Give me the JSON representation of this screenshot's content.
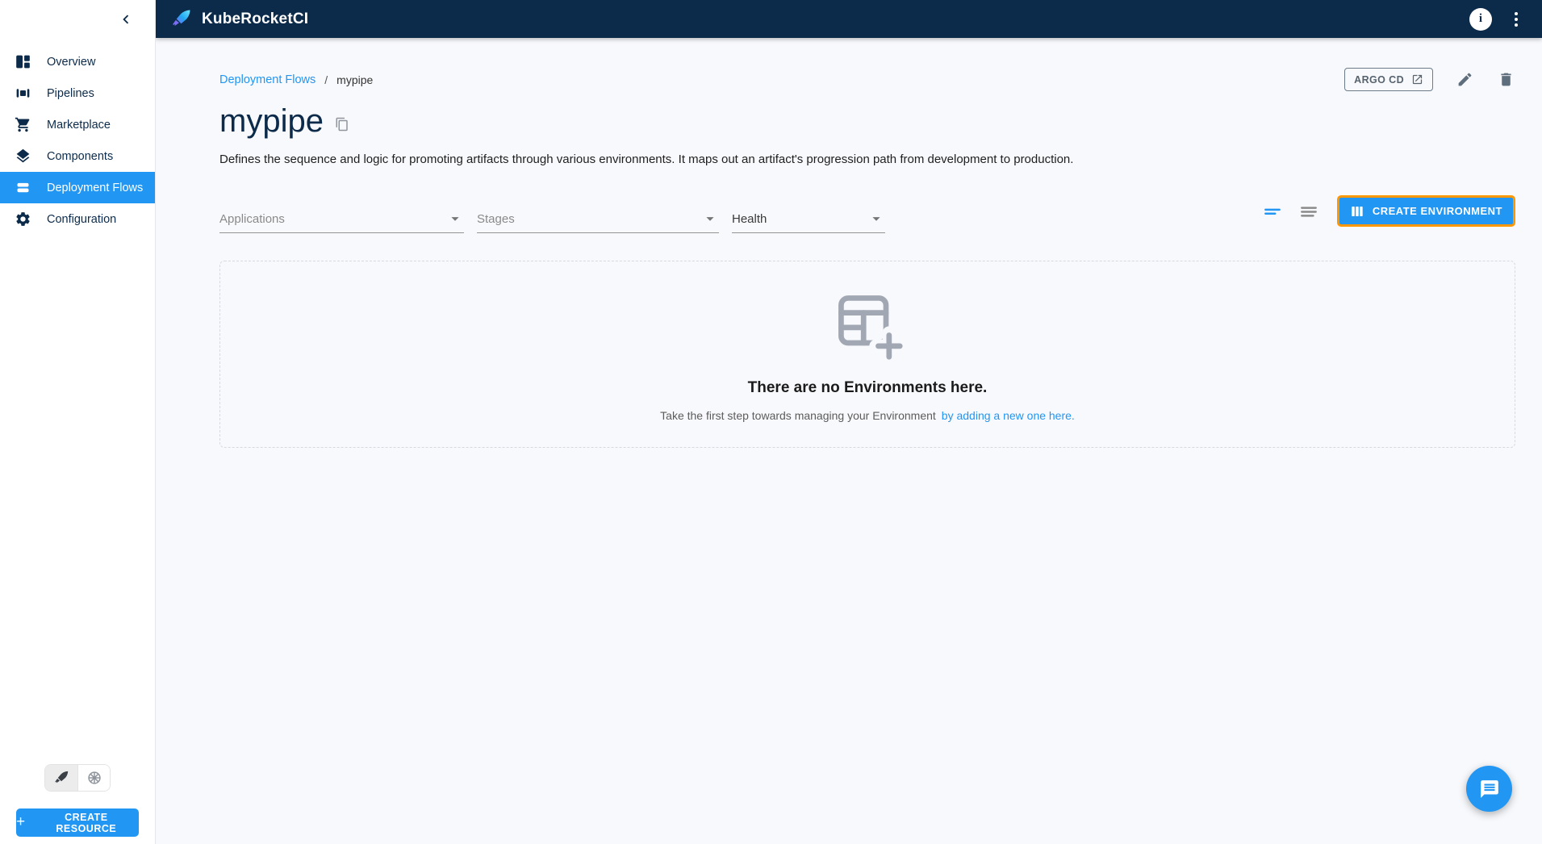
{
  "topbar": {
    "app_title": "KubeRocketCI"
  },
  "sidebar": {
    "items": [
      {
        "label": "Overview",
        "icon": "overview-icon",
        "active": false
      },
      {
        "label": "Pipelines",
        "icon": "pipelines-icon",
        "active": false
      },
      {
        "label": "Marketplace",
        "icon": "marketplace-cart-icon",
        "active": false
      },
      {
        "label": "Components",
        "icon": "components-layers-icon",
        "active": false
      },
      {
        "label": "Deployment Flows",
        "icon": "deployment-flows-icon",
        "active": true
      },
      {
        "label": "Configuration",
        "icon": "configuration-gear-icon",
        "active": false
      }
    ],
    "create_resource_label": "CREATE RESOURCE",
    "create_resource_plus": "+"
  },
  "breadcrumb": {
    "parent": "Deployment Flows",
    "separator": "/",
    "current": "mypipe"
  },
  "header_actions": {
    "argocd_label": "ARGO CD"
  },
  "page": {
    "title": "mypipe",
    "description": "Defines the sequence and logic for promoting artifacts through various environments. It maps out an artifact's progression path from development to production."
  },
  "filters": [
    {
      "label": "Applications"
    },
    {
      "label": "Stages"
    },
    {
      "label": "Health"
    }
  ],
  "toolbar": {
    "create_environment_label": "CREATE ENVIRONMENT"
  },
  "empty_state": {
    "title": "There are no Environments here.",
    "subtitle": "Take the first step towards managing your Environment",
    "link_label": "by adding a new one here."
  },
  "icons": {
    "topbar": [
      "rocket-logo-icon",
      "info-icon",
      "kebab-menu-icon"
    ],
    "header": [
      "external-link-icon",
      "edit-pencil-icon",
      "delete-trash-icon",
      "copy-icon"
    ],
    "toolbar": [
      "view-compact-icon",
      "view-list-icon",
      "columns-icon"
    ],
    "empty": [
      "table-plus-icon"
    ],
    "bottom": [
      "rocket-icon",
      "kubernetes-icon",
      "chat-bubble-icon",
      "chevron-left-icon",
      "dropdown-arrow-icon"
    ]
  },
  "colors": {
    "accent": "#2196f3",
    "topbar_bg": "#0c2b4a",
    "highlight_border": "#ff9800",
    "muted_icon": "#a2a7b4"
  }
}
